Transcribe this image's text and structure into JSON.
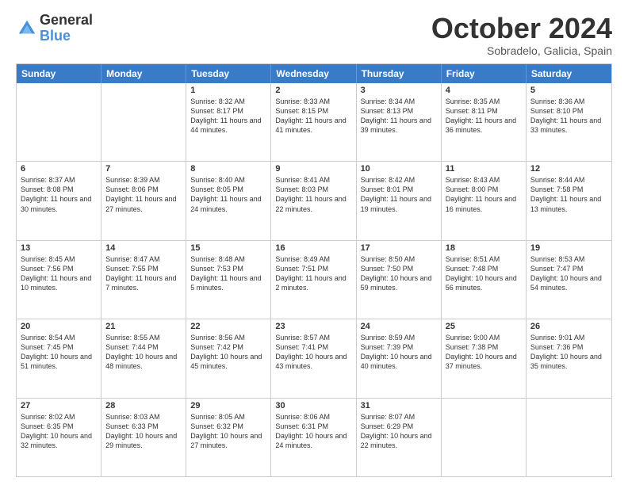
{
  "logo": {
    "general": "General",
    "blue": "Blue"
  },
  "title": {
    "month": "October 2024",
    "location": "Sobradelo, Galicia, Spain"
  },
  "days_of_week": [
    "Sunday",
    "Monday",
    "Tuesday",
    "Wednesday",
    "Thursday",
    "Friday",
    "Saturday"
  ],
  "weeks": [
    [
      {
        "day": "",
        "empty": true
      },
      {
        "day": "",
        "empty": true
      },
      {
        "day": "1",
        "lines": [
          "Sunrise: 8:32 AM",
          "Sunset: 8:17 PM",
          "Daylight: 11 hours and 44 minutes."
        ]
      },
      {
        "day": "2",
        "lines": [
          "Sunrise: 8:33 AM",
          "Sunset: 8:15 PM",
          "Daylight: 11 hours and 41 minutes."
        ]
      },
      {
        "day": "3",
        "lines": [
          "Sunrise: 8:34 AM",
          "Sunset: 8:13 PM",
          "Daylight: 11 hours and 39 minutes."
        ]
      },
      {
        "day": "4",
        "lines": [
          "Sunrise: 8:35 AM",
          "Sunset: 8:11 PM",
          "Daylight: 11 hours and 36 minutes."
        ]
      },
      {
        "day": "5",
        "lines": [
          "Sunrise: 8:36 AM",
          "Sunset: 8:10 PM",
          "Daylight: 11 hours and 33 minutes."
        ]
      }
    ],
    [
      {
        "day": "6",
        "lines": [
          "Sunrise: 8:37 AM",
          "Sunset: 8:08 PM",
          "Daylight: 11 hours and 30 minutes."
        ]
      },
      {
        "day": "7",
        "lines": [
          "Sunrise: 8:39 AM",
          "Sunset: 8:06 PM",
          "Daylight: 11 hours and 27 minutes."
        ]
      },
      {
        "day": "8",
        "lines": [
          "Sunrise: 8:40 AM",
          "Sunset: 8:05 PM",
          "Daylight: 11 hours and 24 minutes."
        ]
      },
      {
        "day": "9",
        "lines": [
          "Sunrise: 8:41 AM",
          "Sunset: 8:03 PM",
          "Daylight: 11 hours and 22 minutes."
        ]
      },
      {
        "day": "10",
        "lines": [
          "Sunrise: 8:42 AM",
          "Sunset: 8:01 PM",
          "Daylight: 11 hours and 19 minutes."
        ]
      },
      {
        "day": "11",
        "lines": [
          "Sunrise: 8:43 AM",
          "Sunset: 8:00 PM",
          "Daylight: 11 hours and 16 minutes."
        ]
      },
      {
        "day": "12",
        "lines": [
          "Sunrise: 8:44 AM",
          "Sunset: 7:58 PM",
          "Daylight: 11 hours and 13 minutes."
        ]
      }
    ],
    [
      {
        "day": "13",
        "lines": [
          "Sunrise: 8:45 AM",
          "Sunset: 7:56 PM",
          "Daylight: 11 hours and 10 minutes."
        ]
      },
      {
        "day": "14",
        "lines": [
          "Sunrise: 8:47 AM",
          "Sunset: 7:55 PM",
          "Daylight: 11 hours and 7 minutes."
        ]
      },
      {
        "day": "15",
        "lines": [
          "Sunrise: 8:48 AM",
          "Sunset: 7:53 PM",
          "Daylight: 11 hours and 5 minutes."
        ]
      },
      {
        "day": "16",
        "lines": [
          "Sunrise: 8:49 AM",
          "Sunset: 7:51 PM",
          "Daylight: 11 hours and 2 minutes."
        ]
      },
      {
        "day": "17",
        "lines": [
          "Sunrise: 8:50 AM",
          "Sunset: 7:50 PM",
          "Daylight: 10 hours and 59 minutes."
        ]
      },
      {
        "day": "18",
        "lines": [
          "Sunrise: 8:51 AM",
          "Sunset: 7:48 PM",
          "Daylight: 10 hours and 56 minutes."
        ]
      },
      {
        "day": "19",
        "lines": [
          "Sunrise: 8:53 AM",
          "Sunset: 7:47 PM",
          "Daylight: 10 hours and 54 minutes."
        ]
      }
    ],
    [
      {
        "day": "20",
        "lines": [
          "Sunrise: 8:54 AM",
          "Sunset: 7:45 PM",
          "Daylight: 10 hours and 51 minutes."
        ]
      },
      {
        "day": "21",
        "lines": [
          "Sunrise: 8:55 AM",
          "Sunset: 7:44 PM",
          "Daylight: 10 hours and 48 minutes."
        ]
      },
      {
        "day": "22",
        "lines": [
          "Sunrise: 8:56 AM",
          "Sunset: 7:42 PM",
          "Daylight: 10 hours and 45 minutes."
        ]
      },
      {
        "day": "23",
        "lines": [
          "Sunrise: 8:57 AM",
          "Sunset: 7:41 PM",
          "Daylight: 10 hours and 43 minutes."
        ]
      },
      {
        "day": "24",
        "lines": [
          "Sunrise: 8:59 AM",
          "Sunset: 7:39 PM",
          "Daylight: 10 hours and 40 minutes."
        ]
      },
      {
        "day": "25",
        "lines": [
          "Sunrise: 9:00 AM",
          "Sunset: 7:38 PM",
          "Daylight: 10 hours and 37 minutes."
        ]
      },
      {
        "day": "26",
        "lines": [
          "Sunrise: 9:01 AM",
          "Sunset: 7:36 PM",
          "Daylight: 10 hours and 35 minutes."
        ]
      }
    ],
    [
      {
        "day": "27",
        "lines": [
          "Sunrise: 8:02 AM",
          "Sunset: 6:35 PM",
          "Daylight: 10 hours and 32 minutes."
        ]
      },
      {
        "day": "28",
        "lines": [
          "Sunrise: 8:03 AM",
          "Sunset: 6:33 PM",
          "Daylight: 10 hours and 29 minutes."
        ]
      },
      {
        "day": "29",
        "lines": [
          "Sunrise: 8:05 AM",
          "Sunset: 6:32 PM",
          "Daylight: 10 hours and 27 minutes."
        ]
      },
      {
        "day": "30",
        "lines": [
          "Sunrise: 8:06 AM",
          "Sunset: 6:31 PM",
          "Daylight: 10 hours and 24 minutes."
        ]
      },
      {
        "day": "31",
        "lines": [
          "Sunrise: 8:07 AM",
          "Sunset: 6:29 PM",
          "Daylight: 10 hours and 22 minutes."
        ]
      },
      {
        "day": "",
        "empty": true
      },
      {
        "day": "",
        "empty": true
      }
    ]
  ]
}
